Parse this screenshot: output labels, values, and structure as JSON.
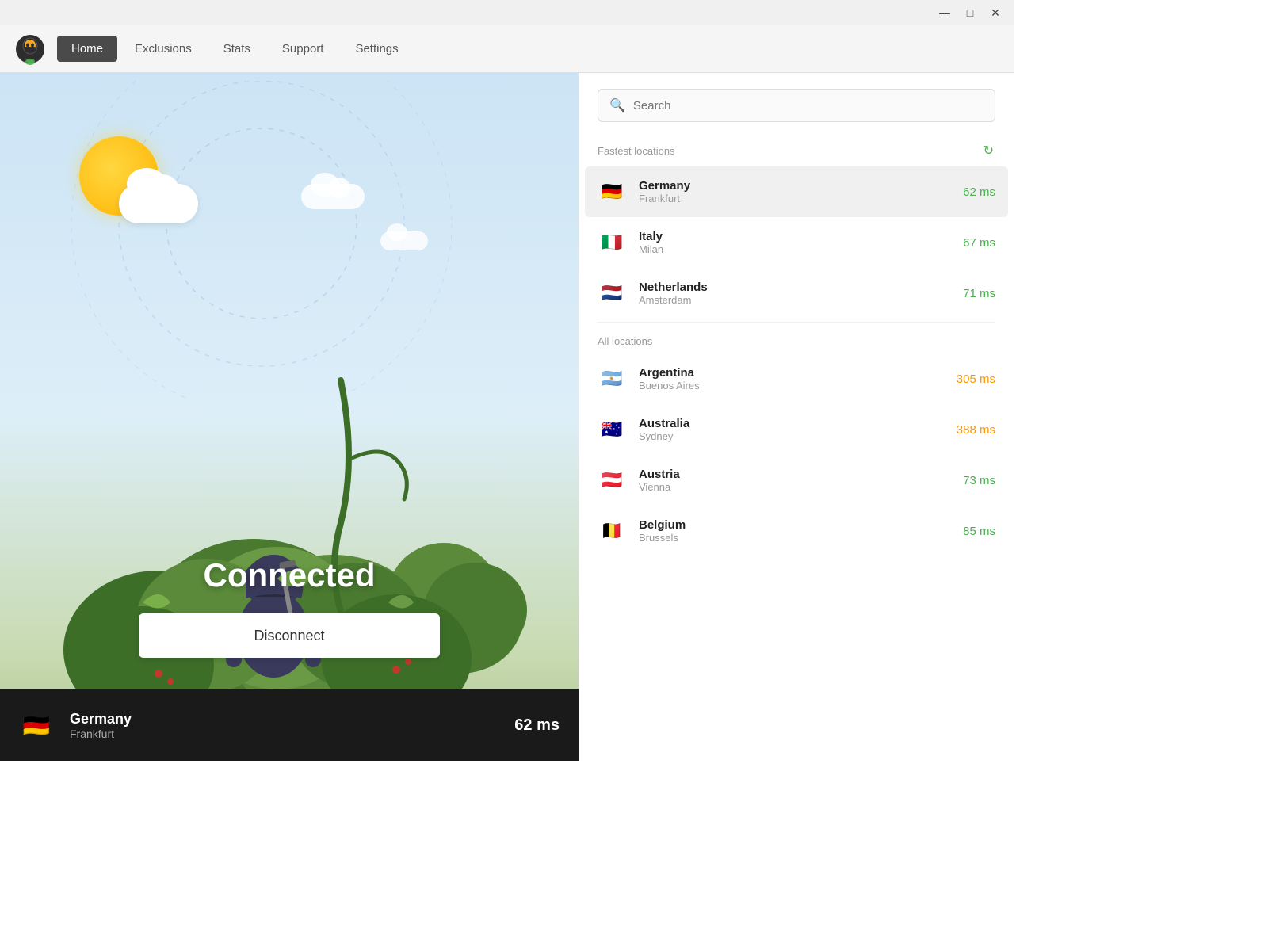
{
  "titleBar": {
    "minimizeLabel": "—",
    "maximizeLabel": "□",
    "closeLabel": "✕"
  },
  "nav": {
    "items": [
      {
        "label": "Home",
        "active": true
      },
      {
        "label": "Exclusions",
        "active": false
      },
      {
        "label": "Stats",
        "active": false
      },
      {
        "label": "Support",
        "active": false
      },
      {
        "label": "Settings",
        "active": false
      }
    ]
  },
  "leftPanel": {
    "connectedLabel": "Connected",
    "disconnectButton": "Disconnect",
    "statusBar": {
      "country": "Germany",
      "city": "Frankfurt",
      "ping": "62 ms",
      "flag": "🇩🇪"
    }
  },
  "rightPanel": {
    "search": {
      "placeholder": "Search"
    },
    "fastestSection": {
      "title": "Fastest locations",
      "refreshTooltip": "Refresh"
    },
    "fastestLocations": [
      {
        "country": "Germany",
        "city": "Frankfurt",
        "ping": "62 ms",
        "pingClass": "ping-green",
        "flag": "🇩🇪",
        "selected": true
      },
      {
        "country": "Italy",
        "city": "Milan",
        "ping": "67 ms",
        "pingClass": "ping-green",
        "flag": "🇮🇹",
        "selected": false
      },
      {
        "country": "Netherlands",
        "city": "Amsterdam",
        "ping": "71 ms",
        "pingClass": "ping-green",
        "flag": "🇳🇱",
        "selected": false
      }
    ],
    "allSection": {
      "title": "All locations"
    },
    "allLocations": [
      {
        "country": "Argentina",
        "city": "Buenos Aires",
        "ping": "305 ms",
        "pingClass": "ping-orange",
        "flag": "🇦🇷",
        "selected": false
      },
      {
        "country": "Australia",
        "city": "Sydney",
        "ping": "388 ms",
        "pingClass": "ping-orange",
        "flag": "🇦🇺",
        "selected": false
      },
      {
        "country": "Austria",
        "city": "Vienna",
        "ping": "73 ms",
        "pingClass": "ping-green",
        "flag": "🇦🇹",
        "selected": false
      },
      {
        "country": "Belgium",
        "city": "Brussels",
        "ping": "85 ms",
        "pingClass": "ping-green",
        "flag": "🇧🇪",
        "selected": false
      }
    ]
  }
}
